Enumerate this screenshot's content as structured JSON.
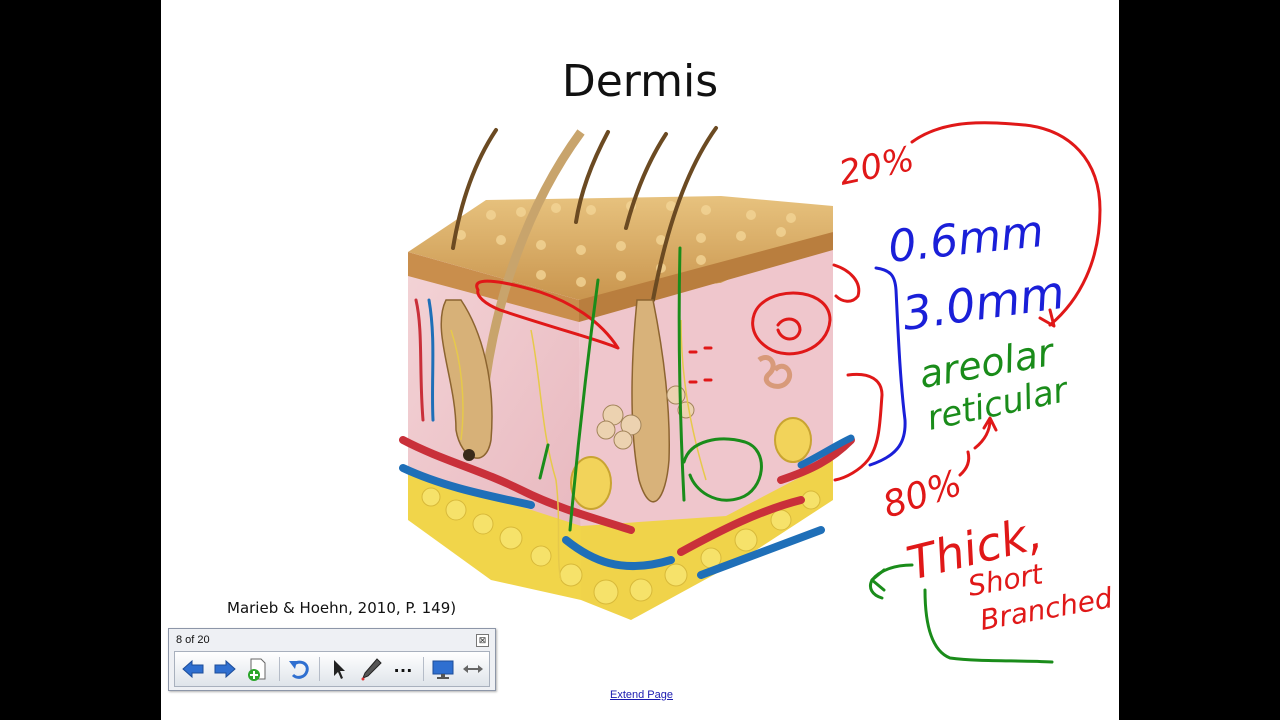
{
  "slide": {
    "title": "Dermis",
    "caption": "Marieb & Hoehn, 2010, P. 149)",
    "extend_link": "Extend Page"
  },
  "toolbar": {
    "page_indicator": "8 of 20",
    "close_glyph": "⊠",
    "buttons": [
      "back-arrow-icon",
      "forward-arrow-icon",
      "add-page-icon",
      "undo-icon",
      "select-pointer-icon",
      "pen-icon",
      "more-icon",
      "screen-display-icon",
      "move-toolbar-icon"
    ]
  },
  "annotations": {
    "red_top": "20%",
    "blue_thin": "0.6mm",
    "blue_thick": "3.0mm",
    "green_areolar": "areolar",
    "green_reticular": "reticular",
    "red_bottom": "80%",
    "red_thick": "Thick,",
    "red_short": "Short",
    "red_branched": "Branched"
  },
  "colors": {
    "background": "#000000",
    "slide": "#ffffff",
    "ink_red": "#e01818",
    "ink_blue": "#1a1fd8",
    "ink_green": "#1a8c1a"
  }
}
